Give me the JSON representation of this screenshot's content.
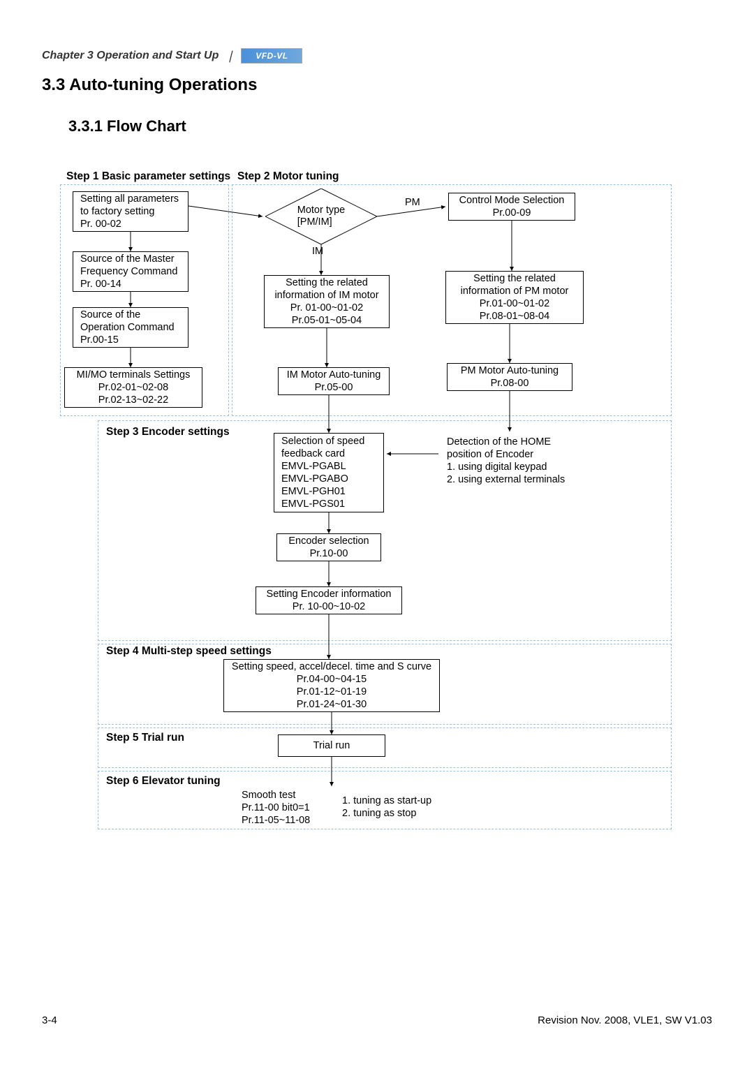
{
  "header": {
    "chapter": "Chapter 3 Operation and Start Up",
    "logo": "VFD-VL"
  },
  "headings": {
    "section": "3.3 Auto-tuning Operations",
    "subsection": "3.3.1 Flow Chart"
  },
  "steps": {
    "s1": "Step 1 Basic parameter settings",
    "s2": "Step 2 Motor tuning",
    "s3": "Step 3 Encoder settings",
    "s4": "Step 4 Multi-step speed settings",
    "s5": "Step 5 Trial run",
    "s6": "Step 6 Elevator tuning"
  },
  "boxes": {
    "factory": "Setting all parameters\nto factory setting\nPr. 00-02",
    "masterfreq": "Source of the Master\nFrequency Command\nPr. 00-14",
    "opcmd": "Source of the\nOperation Command\nPr.00-15",
    "mimo": "MI/MO terminals Settings\nPr.02-01~02-08\nPr.02-13~02-22",
    "motortype": "Motor type\n[PM/IM]",
    "pm": "PM",
    "im": "IM",
    "ctrlmode": "Control Mode Selection\nPr.00-09",
    "im_info": "Setting the related\ninformation of IM motor\nPr. 01-00~01-02\nPr.05-01~05-04",
    "pm_info": "Setting the related\ninformation of PM motor\nPr.01-00~01-02\nPr.08-01~08-04",
    "im_auto": "IM Motor Auto-tuning\nPr.05-00",
    "pm_auto": "PM Motor Auto-tuning\nPr.08-00",
    "feedback": "Selection of speed\nfeedback card\nEMVL-PGABL\nEMVL-PGABO\nEMVL-PGH01\nEMVL-PGS01",
    "home": "Detection of the HOME\nposition of Encoder\n1. using digital keypad\n2. using external terminals",
    "encsel": "Encoder selection\nPr.10-00",
    "encinfo": "Setting Encoder information\nPr. 10-00~10-02",
    "speed": "Setting speed, accel/decel. time and S curve\nPr.04-00~04-15\nPr.01-12~01-19\nPr.01-24~01-30",
    "trial": "Trial run",
    "smooth_l": "Smooth test\nPr.11-00 bit0=1\nPr.11-05~11-08",
    "smooth_r": "1. tuning as start-up\n2. tuning as stop"
  },
  "footer": {
    "page": "3-4",
    "rev": "Revision Nov. 2008, VLE1, SW V1.03"
  },
  "chart_data": {
    "type": "flowchart",
    "nodes": [
      {
        "id": "factory",
        "step": 1,
        "text": "Setting all parameters to factory setting Pr.00-02"
      },
      {
        "id": "masterfreq",
        "step": 1,
        "text": "Source of the Master Frequency Command Pr.00-14"
      },
      {
        "id": "opcmd",
        "step": 1,
        "text": "Source of the Operation Command Pr.00-15"
      },
      {
        "id": "mimo",
        "step": 1,
        "text": "MI/MO terminals Settings Pr.02-01~02-08 Pr.02-13~02-22"
      },
      {
        "id": "motortype",
        "step": 2,
        "type": "decision",
        "text": "Motor type [PM/IM]"
      },
      {
        "id": "ctrlmode",
        "step": 2,
        "text": "Control Mode Selection Pr.00-09"
      },
      {
        "id": "im_info",
        "step": 2,
        "text": "Setting the related information of IM motor Pr.01-00~01-02 Pr.05-01~05-04"
      },
      {
        "id": "pm_info",
        "step": 2,
        "text": "Setting the related information of PM motor Pr.01-00~01-02 Pr.08-01~08-04"
      },
      {
        "id": "im_auto",
        "step": 2,
        "text": "IM Motor Auto-tuning Pr.05-00"
      },
      {
        "id": "pm_auto",
        "step": 2,
        "text": "PM Motor Auto-tuning Pr.08-00"
      },
      {
        "id": "feedback",
        "step": 3,
        "text": "Selection of speed feedback card EMVL-PGABL EMVL-PGABO EMVL-PGH01 EMVL-PGS01"
      },
      {
        "id": "home",
        "step": 3,
        "text": "Detection of the HOME position of Encoder 1. using digital keypad 2. using external terminals"
      },
      {
        "id": "encsel",
        "step": 3,
        "text": "Encoder selection Pr.10-00"
      },
      {
        "id": "encinfo",
        "step": 3,
        "text": "Setting Encoder information Pr.10-00~10-02"
      },
      {
        "id": "speed",
        "step": 4,
        "text": "Setting speed, accel/decel. time and S curve Pr.04-00~04-15 Pr.01-12~01-19 Pr.01-24~01-30"
      },
      {
        "id": "trial",
        "step": 5,
        "text": "Trial run"
      },
      {
        "id": "smooth",
        "step": 6,
        "text": "Smooth test Pr.11-00 bit0=1 Pr.11-05~11-08 / 1. tuning as start-up 2. tuning as stop"
      }
    ],
    "edges": [
      {
        "from": "factory",
        "to": "masterfreq"
      },
      {
        "from": "masterfreq",
        "to": "opcmd"
      },
      {
        "from": "opcmd",
        "to": "mimo"
      },
      {
        "from": "factory",
        "to": "motortype"
      },
      {
        "from": "motortype",
        "to": "ctrlmode",
        "label": "PM"
      },
      {
        "from": "motortype",
        "to": "im_info",
        "label": "IM"
      },
      {
        "from": "ctrlmode",
        "to": "pm_info"
      },
      {
        "from": "im_info",
        "to": "im_auto"
      },
      {
        "from": "pm_info",
        "to": "pm_auto"
      },
      {
        "from": "pm_auto",
        "to": "home"
      },
      {
        "from": "home",
        "to": "feedback"
      },
      {
        "from": "im_auto",
        "to": "feedback"
      },
      {
        "from": "feedback",
        "to": "encsel"
      },
      {
        "from": "encsel",
        "to": "encinfo"
      },
      {
        "from": "encinfo",
        "to": "speed"
      },
      {
        "from": "speed",
        "to": "trial"
      },
      {
        "from": "trial",
        "to": "smooth"
      }
    ]
  }
}
